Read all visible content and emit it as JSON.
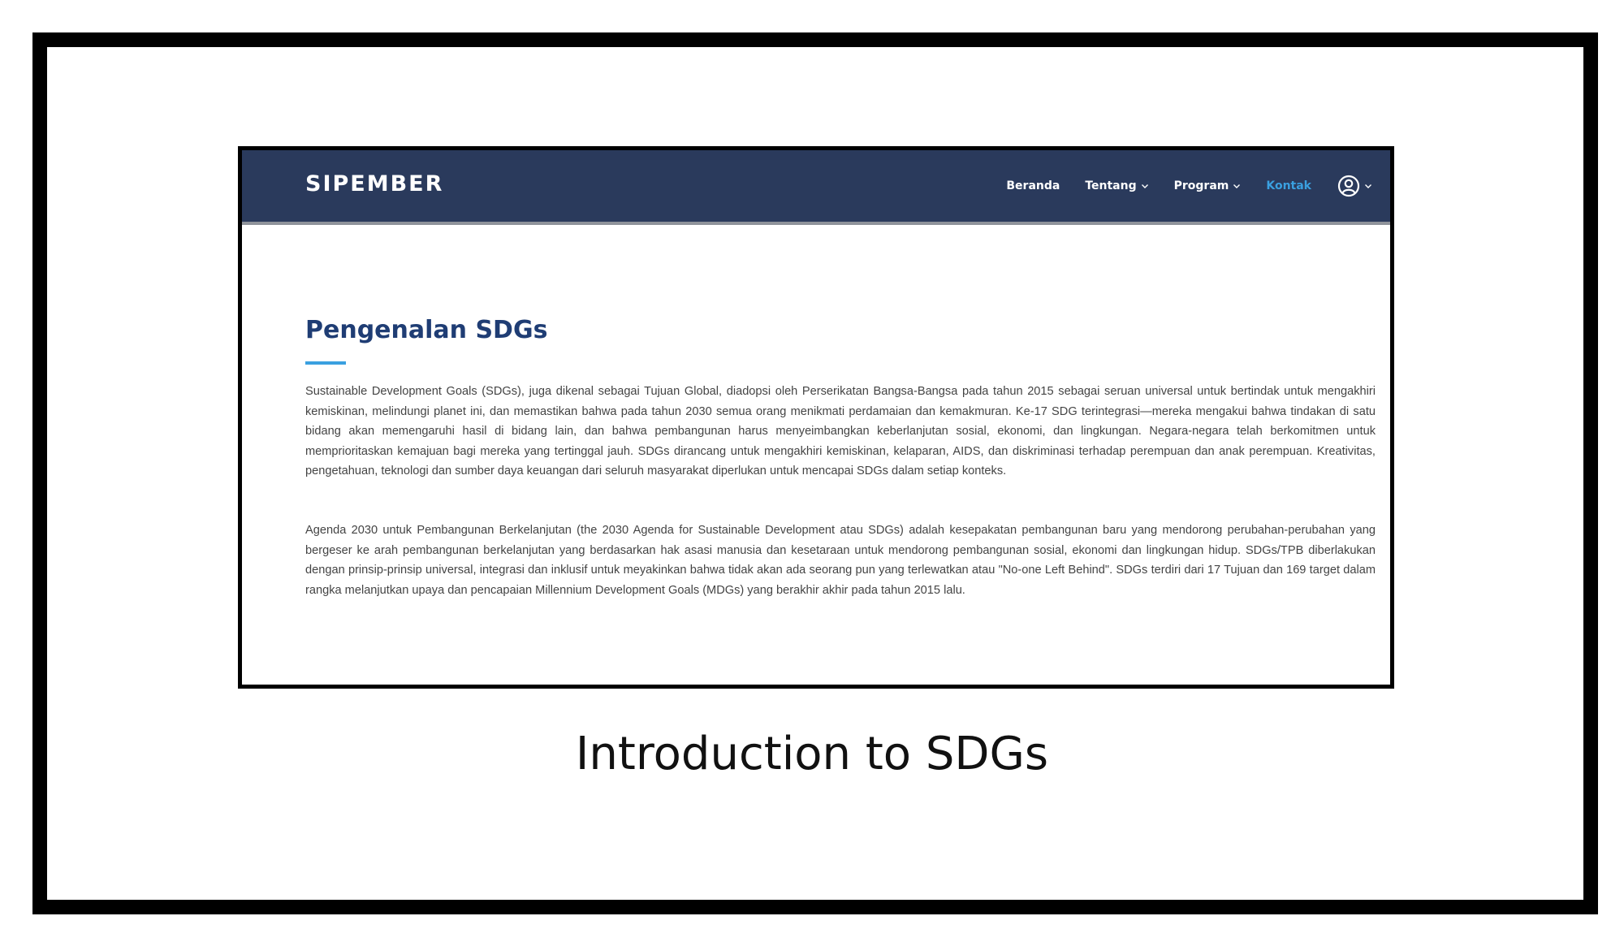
{
  "navbar": {
    "brand": "SIPEMBER",
    "items": [
      {
        "label": "Beranda",
        "dropdown": false,
        "active": false
      },
      {
        "label": "Tentang",
        "dropdown": true,
        "active": false
      },
      {
        "label": "Program",
        "dropdown": true,
        "active": false
      },
      {
        "label": "Kontak",
        "dropdown": false,
        "active": true
      }
    ],
    "user_icon": "user-circle-icon"
  },
  "main": {
    "title": "Pengenalan SDGs",
    "paragraphs": [
      "Sustainable Development Goals (SDGs), juga dikenal sebagai Tujuan Global, diadopsi oleh Perserikatan Bangsa-Bangsa pada tahun 2015 sebagai seruan universal untuk bertindak untuk mengakhiri kemiskinan, melindungi planet ini, dan memastikan bahwa pada tahun 2030 semua orang menikmati perdamaian dan kemakmuran. Ke-17 SDG terintegrasi—mereka mengakui bahwa tindakan di satu bidang akan memengaruhi hasil di bidang lain, dan bahwa pembangunan harus menyeimbangkan keberlanjutan sosial, ekonomi, dan lingkungan. Negara-negara telah berkomitmen untuk memprioritaskan kemajuan bagi mereka yang tertinggal jauh. SDGs dirancang untuk mengakhiri kemiskinan, kelaparan, AIDS, dan diskriminasi terhadap perempuan dan anak perempuan. Kreativitas, pengetahuan, teknologi dan sumber daya keuangan dari seluruh masyarakat diperlukan untuk mencapai SDGs dalam setiap konteks.",
      "Agenda 2030 untuk Pembangunan Berkelanjutan (the 2030 Agenda for Sustainable Development atau SDGs) adalah kesepakatan pembangunan baru yang mendorong perubahan-perubahan yang bergeser ke arah pembangunan berkelanjutan yang berdasarkan hak asasi manusia dan kesetaraan untuk mendorong pembangunan sosial, ekonomi dan lingkungan hidup. SDGs/TPB diberlakukan dengan prinsip-prinsip universal, integrasi dan inklusif untuk meyakinkan bahwa tidak akan ada seorang pun yang terlewatkan atau \"No-one Left Behind\". SDGs terdiri dari 17 Tujuan dan 169 target dalam rangka melanjutkan upaya dan pencapaian Millennium Development Goals (MDGs) yang berakhir akhir pada tahun 2015 lalu."
    ]
  },
  "caption": "Introduction to SDGs",
  "colors": {
    "navbar_bg": "#2a3a5c",
    "accent": "#3aa0e0",
    "title": "#1f3d74"
  }
}
